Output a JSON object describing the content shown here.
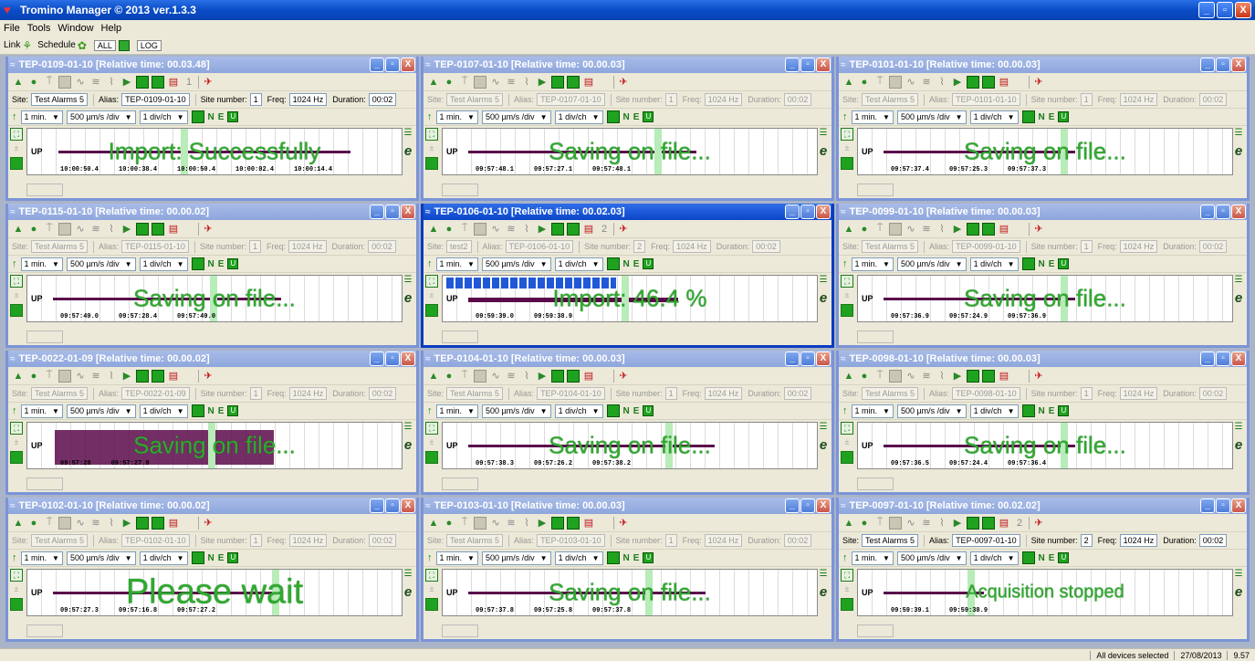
{
  "app": {
    "title": "Tromino Manager © 2013 ver.1.3.3",
    "controls": {
      "minimize": "_",
      "maximize": "▫",
      "close": "X"
    }
  },
  "menu": [
    "File",
    "Tools",
    "Window",
    "Help"
  ],
  "toolbar": {
    "link_label": "Link",
    "schedule_label": "Schedule",
    "all_label": "ALL",
    "log_label": "LOG"
  },
  "common": {
    "interval": "1 min.",
    "speed": "500 µm/s /div",
    "scale": "1 div/ch",
    "n_label": "N",
    "e_label": "E",
    "u_label": "U",
    "up_label": "UP",
    "site_label": "Site:",
    "alias_label": "Alias:",
    "site_number_label": "Site number:",
    "freq_label": "Freq:",
    "duration_label": "Duration:",
    "freq_value": "1024 Hz",
    "duration_value": "00:02"
  },
  "colors": {
    "accent_title": "#0b45c8",
    "message_green": "#2faa2f",
    "trace": "#5a0a4a"
  },
  "windows": [
    {
      "title": "TEP-0109-01-10   [Relative time: 00.03.48]",
      "site": "Test Alarms 5",
      "alias": "TEP-0109-01-10",
      "site_number": "1",
      "enabled": true,
      "active": false,
      "message": "Import: Successfully",
      "msg_size": "normal",
      "ticks": [
        "10:00:50.4",
        "10:00:38.4",
        "10:00:50.4",
        "10:00:02.4",
        "10:00:14.4"
      ],
      "badge": "1"
    },
    {
      "title": "TEP-0107-01-10   [Relative time: 00.00.03]",
      "site": "Test Alarms 5",
      "alias": "TEP-0107-01-10",
      "site_number": "1",
      "enabled": false,
      "active": false,
      "message": "Saving on file...",
      "msg_size": "normal",
      "ticks": [
        "09:57:48.1",
        "09:57:27.1",
        "09:57:48.1"
      ],
      "badge": ""
    },
    {
      "title": "TEP-0101-01-10   [Relative time: 00.00.03]",
      "site": "Test Alarms 5",
      "alias": "TEP-0101-01-10",
      "site_number": "1",
      "enabled": false,
      "active": false,
      "message": "Saving on file...",
      "msg_size": "normal",
      "ticks": [
        "09:57:37.4",
        "09:57:25.3",
        "09:57:37.3"
      ],
      "badge": ""
    },
    {
      "title": "TEP-0115-01-10   [Relative time: 00.00.02]",
      "site": "Test Alarms 5",
      "alias": "TEP-0115-01-10",
      "site_number": "1",
      "enabled": false,
      "active": false,
      "message": "Saving on file...",
      "msg_size": "normal",
      "ticks": [
        "09:57:49.0",
        "09:57:28.4",
        "09:57:49.0"
      ],
      "badge": ""
    },
    {
      "title": "TEP-0106-01-10   [Relative time: 00.02.03]",
      "site": "test2",
      "alias": "TEP-0106-01-10",
      "site_number": "2",
      "enabled": false,
      "active": true,
      "message": "Import:  46.4 %",
      "msg_size": "normal",
      "progress": 46.4,
      "ticks": [
        "09:59:39.0",
        "09:59:38.9"
      ],
      "badge": "2"
    },
    {
      "title": "TEP-0099-01-10   [Relative time: 00.00.03]",
      "site": "Test Alarms 5",
      "alias": "TEP-0099-01-10",
      "site_number": "1",
      "enabled": false,
      "active": false,
      "message": "Saving on file...",
      "msg_size": "normal",
      "ticks": [
        "09:57:36.9",
        "09:57:24.9",
        "09:57:36.9"
      ],
      "badge": ""
    },
    {
      "title": "TEP-0022-01-09   [Relative time: 00.00.02]",
      "site": "Test Alarms 5",
      "alias": "TEP-0022-01-09",
      "site_number": "1",
      "enabled": false,
      "active": false,
      "message": "Saving on file...",
      "msg_size": "normal",
      "ticks": [
        "09:57:28",
        "09:57:27.9"
      ],
      "badge": ""
    },
    {
      "title": "TEP-0104-01-10   [Relative time: 00.00.03]",
      "site": "Test Alarms 5",
      "alias": "TEP-0104-01-10",
      "site_number": "1",
      "enabled": false,
      "active": false,
      "message": "Saving on file...",
      "msg_size": "normal",
      "ticks": [
        "09:57:38.3",
        "09:57:26.2",
        "09:57:38.2"
      ],
      "badge": ""
    },
    {
      "title": "TEP-0098-01-10   [Relative time: 00.00.03]",
      "site": "Test Alarms 5",
      "alias": "TEP-0098-01-10",
      "site_number": "1",
      "enabled": false,
      "active": false,
      "message": "Saving on file...",
      "msg_size": "normal",
      "ticks": [
        "09:57:36.5",
        "09:57:24.4",
        "09:57:36.4"
      ],
      "badge": ""
    },
    {
      "title": "TEP-0102-01-10   [Relative time: 00.00.02]",
      "site": "Test Alarms 5",
      "alias": "TEP-0102-01-10",
      "site_number": "1",
      "enabled": false,
      "active": false,
      "message": "Please wait",
      "msg_size": "big",
      "ticks": [
        "09:57:27.3",
        "09:57:16.8",
        "09:57:27.2"
      ],
      "badge": ""
    },
    {
      "title": "TEP-0103-01-10   [Relative time: 00.00.03]",
      "site": "Test Alarms 5",
      "alias": "TEP-0103-01-10",
      "site_number": "1",
      "enabled": false,
      "active": false,
      "message": "Saving on file...",
      "msg_size": "normal",
      "ticks": [
        "09:57:37.8",
        "09:57:25.8",
        "09:57:37.8"
      ],
      "badge": ""
    },
    {
      "title": "TEP-0097-01-10   [Relative time: 00.02.02]",
      "site": "Test Alarms 5",
      "alias": "TEP-0097-01-10",
      "site_number": "2",
      "enabled": true,
      "active": false,
      "message": "Acquisition stopped",
      "msg_size": "small",
      "ticks": [
        "09:59:39.1",
        "09:59:38.9"
      ],
      "badge": "2"
    }
  ],
  "statusbar": {
    "selection": "All devices selected",
    "date": "27/08/2013",
    "time": "9.57"
  }
}
